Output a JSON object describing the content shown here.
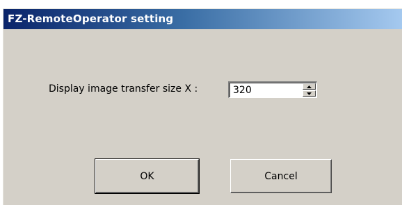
{
  "window": {
    "title": "FZ-RemoteOperator setting"
  },
  "form": {
    "label": "Display image transfer size X :",
    "value": "320"
  },
  "buttons": {
    "ok_label": "OK",
    "cancel_label": "Cancel"
  },
  "colors": {
    "title_gradient_start": "#0a246a",
    "title_gradient_end": "#a6caf0",
    "dialog_face": "#d4d0c8"
  },
  "icons": {
    "spin_up": "spin-up-arrow-icon",
    "spin_down": "spin-down-arrow-icon"
  }
}
